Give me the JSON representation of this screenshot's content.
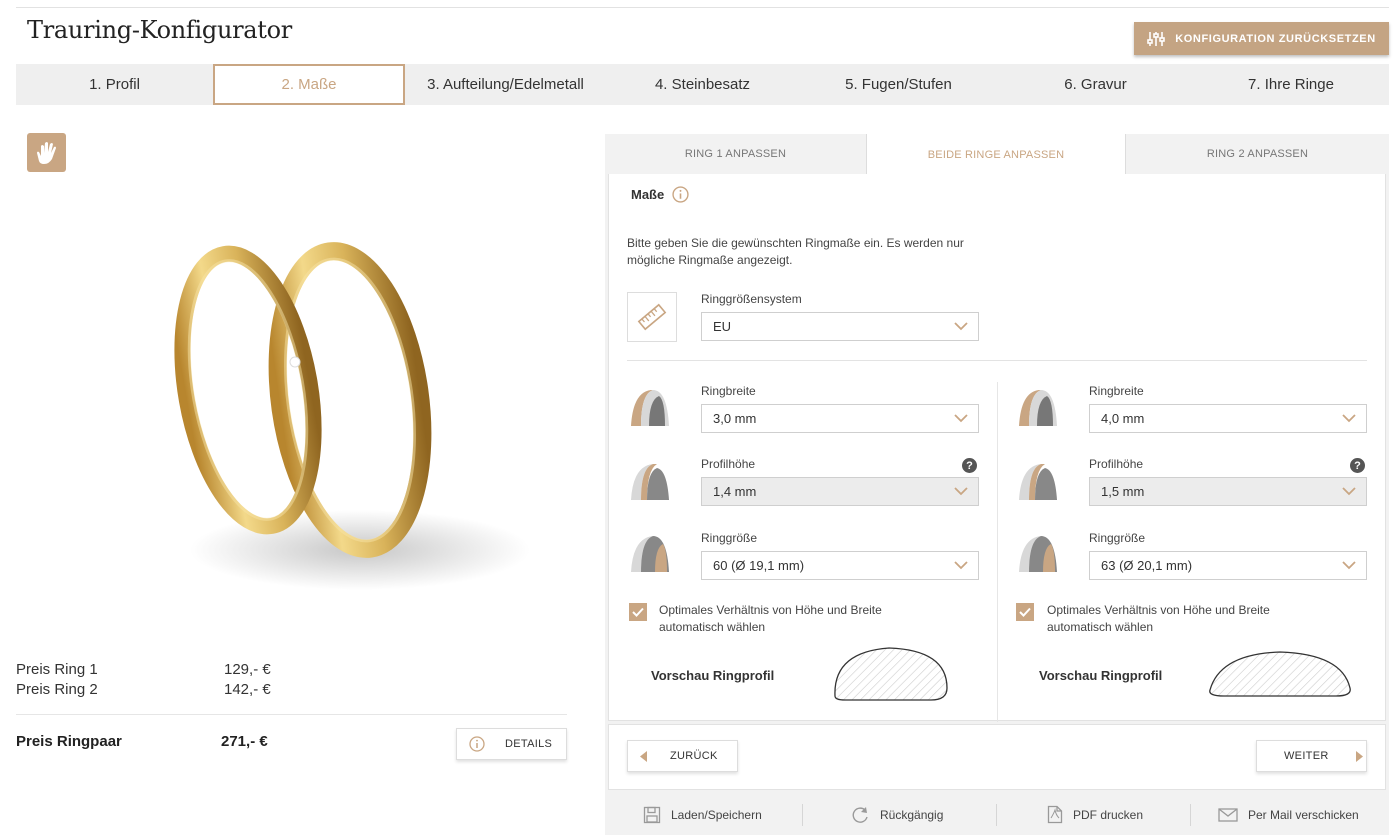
{
  "app": {
    "title": "Trauring-Konfigurator",
    "reset_label": "KONFIGURATION ZURÜCKSETZEN"
  },
  "steps": [
    "1. Profil",
    "2. Maße",
    "3. Aufteilung/Edelmetall",
    "4. Steinbesatz",
    "5. Fugen/Stufen",
    "6. Gravur",
    "7. Ihre Ringe"
  ],
  "active_step": "2. Maße",
  "colors": {
    "accent": "#c9a683",
    "reset_bg": "#c4a483",
    "panel_bg": "#f2f2f2",
    "gold": "#d9b35a"
  },
  "pricing": {
    "ring1_label": "Preis Ring 1",
    "ring1_value": "129,- €",
    "ring2_label": "Preis Ring 2",
    "ring2_value": "142,- €",
    "pair_label": "Preis Ringpaar",
    "pair_value": "271,- €",
    "details_label": "DETAILS"
  },
  "tabs": {
    "ring1": "RING 1 ANPASSEN",
    "both": "BEIDE RINGE ANPASSEN",
    "ring2": "RING 2 ANPASSEN",
    "active": "both"
  },
  "config": {
    "section_title": "Maße",
    "intro": "Bitte geben Sie die gewünschten Ringmaße ein. Es werden nur mögliche Ringmaße angezeigt.",
    "size_system": {
      "label": "Ringgrößensystem",
      "value": "EU"
    },
    "ring1": {
      "width": {
        "label": "Ringbreite",
        "value": "3,0 mm"
      },
      "height": {
        "label": "Profilhöhe",
        "value": "1,4 mm"
      },
      "size": {
        "label": "Ringgröße",
        "value": "60 (Ø 19,1 mm)"
      },
      "auto_ratio": {
        "label": "Optimales Verhältnis von Höhe und Breite automatisch wählen",
        "checked": true
      },
      "preview_label": "Vorschau Ringprofil"
    },
    "ring2": {
      "width": {
        "label": "Ringbreite",
        "value": "4,0 mm"
      },
      "height": {
        "label": "Profilhöhe",
        "value": "1,5 mm"
      },
      "size": {
        "label": "Ringgröße",
        "value": "63 (Ø 20,1 mm)"
      },
      "auto_ratio": {
        "label": "Optimales Verhältnis von Höhe und Breite automatisch wählen",
        "checked": true
      },
      "preview_label": "Vorschau Ringprofil"
    },
    "help_glyph": "?"
  },
  "nav": {
    "back": "ZURÜCK",
    "next": "WEITER"
  },
  "footer": {
    "save": "Laden/Speichern",
    "undo": "Rückgängig",
    "pdf": "PDF drucken",
    "mail": "Per Mail verschicken"
  },
  "icons": [
    "sliders-icon",
    "hand-icon",
    "info-icon",
    "ruler-icon",
    "ring-width-icon",
    "ring-height-icon",
    "ring-size-icon",
    "chevron-down-icon",
    "check-icon",
    "arrow-left-icon",
    "arrow-right-icon",
    "save-icon",
    "undo-icon",
    "pdf-icon",
    "mail-icon"
  ]
}
